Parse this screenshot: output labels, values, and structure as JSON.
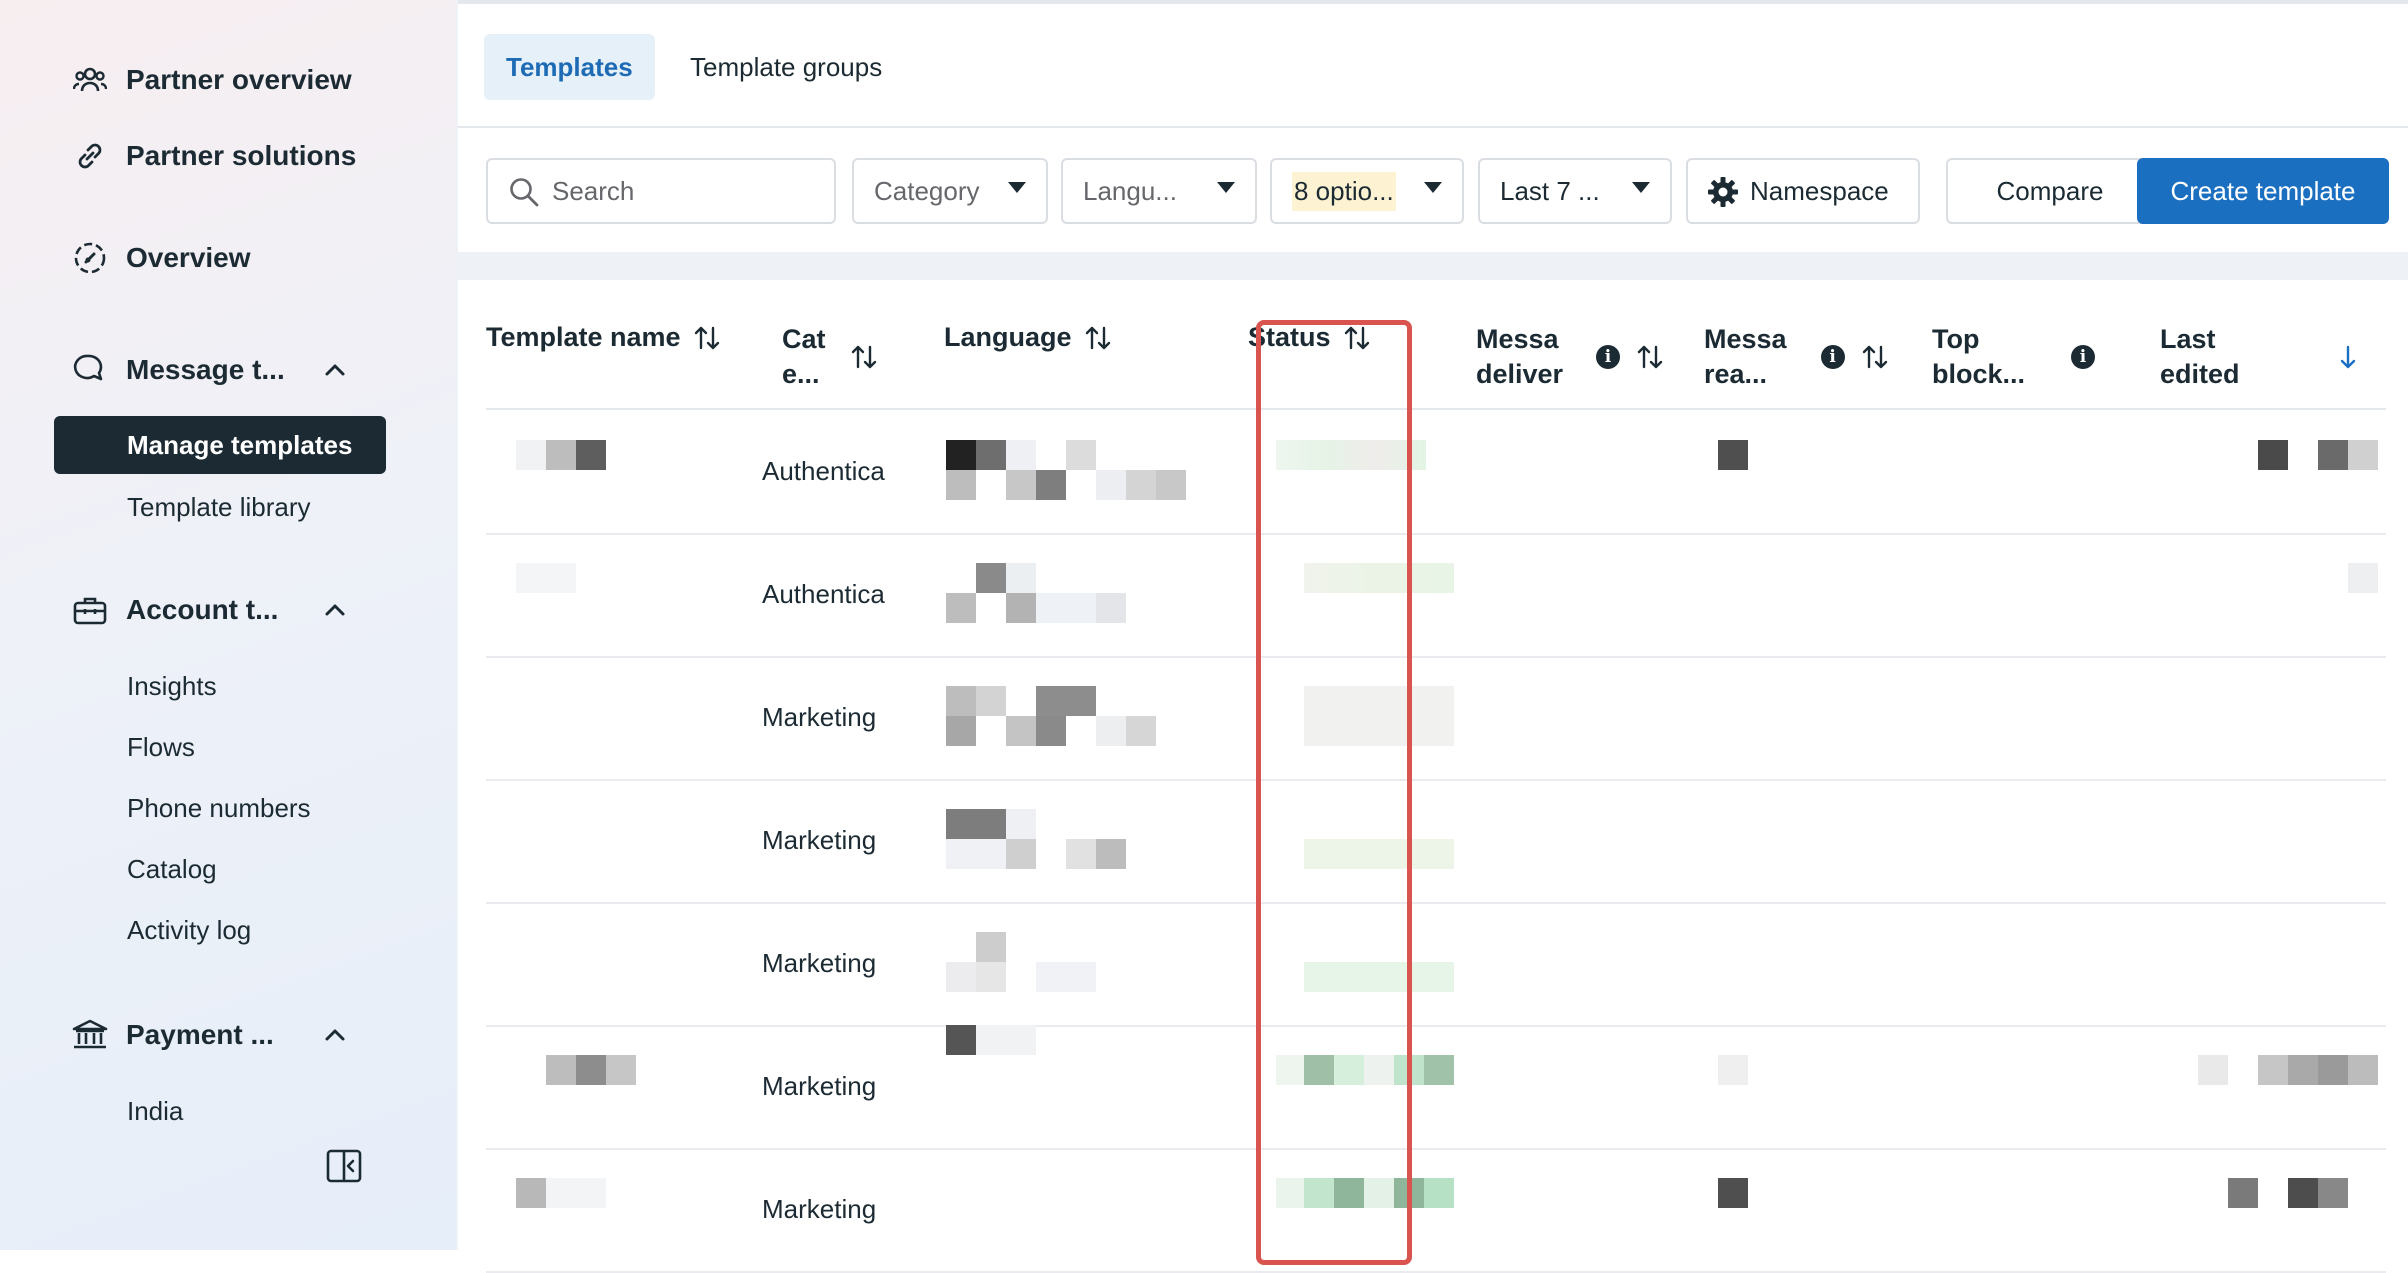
{
  "sidebar": {
    "primary": [
      {
        "label": "Partner overview",
        "icon": "people-icon"
      },
      {
        "label": "Partner solutions",
        "icon": "link-icon"
      },
      {
        "label": "Overview",
        "icon": "gauge-icon"
      }
    ],
    "sections": [
      {
        "label": "Message t...",
        "icon": "chat-icon",
        "expanded": true,
        "items": [
          "Manage templates",
          "Template library"
        ],
        "active_item": "Manage templates"
      },
      {
        "label": "Account t...",
        "icon": "briefcase-icon",
        "expanded": true,
        "items": [
          "Insights",
          "Flows",
          "Phone numbers",
          "Catalog",
          "Activity log"
        ]
      },
      {
        "label": "Payment ...",
        "icon": "bank-icon",
        "expanded": true,
        "items": [
          "India"
        ]
      }
    ],
    "collapse_icon": "sidebar-collapse-icon"
  },
  "tabs": [
    {
      "label": "Templates",
      "active": true
    },
    {
      "label": "Template groups",
      "active": false
    }
  ],
  "toolbar": {
    "search_placeholder": "Search",
    "category": "Category",
    "language": "Langu...",
    "status": "8 optio...",
    "date": "Last 7 ...",
    "namespace": "Namespace",
    "compare": "Compare",
    "create": "Create template"
  },
  "table": {
    "columns": [
      {
        "label": "Template name",
        "sort": "both"
      },
      {
        "label": "Cat\ne...",
        "sort": "both"
      },
      {
        "label": "Language",
        "sort": "both"
      },
      {
        "label": "Status",
        "sort": "both"
      },
      {
        "label": "Messa\ndeliver",
        "sort": "both",
        "info": true
      },
      {
        "label": "Messa\nrea...",
        "sort": "both",
        "info": true
      },
      {
        "label": "Top\nblock...",
        "info": true
      },
      {
        "label": "Last\nedited",
        "sort": "desc"
      }
    ],
    "rows": [
      {
        "category": "Authentica"
      },
      {
        "category": "Authentica"
      },
      {
        "category": "Marketing"
      },
      {
        "category": "Marketing"
      },
      {
        "category": "Marketing"
      },
      {
        "category": "Marketing"
      },
      {
        "category": "Marketing"
      }
    ]
  },
  "colors": {
    "primary_blue": "#1b6fc1",
    "active_tab_bg": "#e6f0f9",
    "active_nav_bg": "#1c2b33",
    "highlight_red": "#d9534f",
    "status_chip_bg": "#fdf3d3"
  }
}
